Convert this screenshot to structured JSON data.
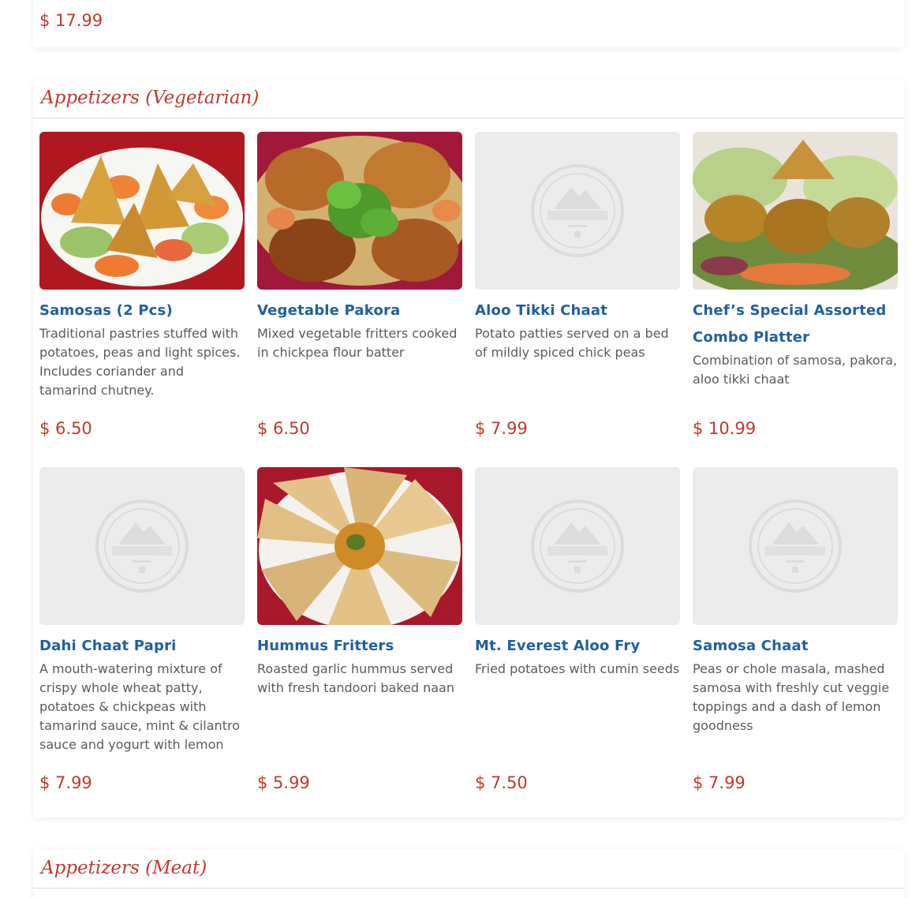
{
  "top_card": {
    "price": "$ 17.99"
  },
  "sections": [
    {
      "title": "Appetizers (Vegetarian)",
      "items": [
        {
          "name": "Samosas (2 Pcs)",
          "desc": "Traditional pastries stuffed with potatoes, peas and light spices. Includes coriander and tamarind chutney.",
          "price": "$ 6.50",
          "image": "samosa-photo"
        },
        {
          "name": "Vegetable Pakora",
          "desc": "Mixed vegetable fritters cooked in chickpea flour batter",
          "price": "$ 6.50",
          "image": "pakora-photo"
        },
        {
          "name": "Aloo Tikki Chaat",
          "desc": "Potato patties served on a bed of mildly spiced chick peas",
          "price": "$ 7.99",
          "image": "placeholder-logo"
        },
        {
          "name": "Chef’s Special Assorted Combo Platter",
          "desc": "Combination of samosa, pakora, aloo tikki chaat",
          "price": "$ 10.99",
          "image": "combo-photo"
        },
        {
          "name": "Dahi Chaat Papri",
          "desc": "A mouth-watering mixture of crispy whole wheat patty, potatoes & chickpeas with tamarind sauce, mint & cilantro sauce and yogurt with lemon",
          "price": "$ 7.99",
          "image": "placeholder-logo"
        },
        {
          "name": "Hummus Fritters",
          "desc": "Roasted garlic hummus served with fresh tandoori baked naan",
          "price": "$ 5.99",
          "image": "hummus-photo"
        },
        {
          "name": "Mt. Everest Aloo Fry",
          "desc": "Fried potatoes with cumin seeds",
          "price": "$ 7.50",
          "image": "placeholder-logo"
        },
        {
          "name": "Samosa Chaat",
          "desc": "Peas or chole masala, mashed samosa with freshly cut veggie toppings and a dash of lemon goodness",
          "price": "$ 7.99",
          "image": "placeholder-logo"
        }
      ]
    },
    {
      "title": "Appetizers (Meat)"
    }
  ],
  "placeholder_logo_text": "MOUNT EVEREST"
}
